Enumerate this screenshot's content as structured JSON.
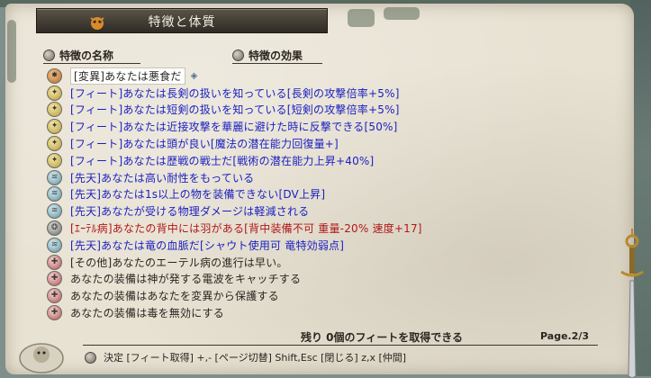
{
  "window": {
    "title": "特徴と体質"
  },
  "headers": {
    "name": "特徴の名称",
    "effect": "特徴の効果"
  },
  "colors": {
    "text_blue": "#1a1fc0",
    "text_red": "#b01818",
    "text_dark": "#2a2620",
    "title_bg": "#3a352d"
  },
  "traits": [
    {
      "icon": "mutation",
      "color": "dark",
      "text": "[変異]あなたは悪食だ",
      "selected": true
    },
    {
      "icon": "feat",
      "color": "blue",
      "text": "[フィート]あなたは長剣の扱いを知っている[長剣の攻撃倍率+5%]"
    },
    {
      "icon": "feat",
      "color": "blue",
      "text": "[フィート]あなたは短剣の扱いを知っている[短剣の攻撃倍率+5%]"
    },
    {
      "icon": "feat",
      "color": "blue",
      "text": "[フィート]あなたは近接攻撃を華麗に避けた時に反撃できる[50%]"
    },
    {
      "icon": "feat",
      "color": "blue",
      "text": "[フィート]あなたは頭が良い[魔法の潜在能力回復量+]"
    },
    {
      "icon": "feat",
      "color": "blue",
      "text": "[フィート]あなたは歴戦の戦士だ[戦術の潜在能力上昇+40%]"
    },
    {
      "icon": "innate",
      "color": "blue",
      "text": "[先天]あなたは高い耐性をもっている"
    },
    {
      "icon": "innate",
      "color": "blue",
      "text": "[先天]あなたは1s以上の物を装備できない[DV上昇]"
    },
    {
      "icon": "innate",
      "color": "blue",
      "text": "[先天]あなたが受ける物理ダメージは軽減される"
    },
    {
      "icon": "ether",
      "color": "red",
      "text": "[ｴｰﾃﾙ病]あなたの背中には羽がある[背中装備不可 重量-20% 速度+17]"
    },
    {
      "icon": "innate",
      "color": "blue",
      "text": "[先天]あなたは竜の血脈だ[シャウト使用可 竜特効弱点]"
    },
    {
      "icon": "other",
      "color": "dark",
      "text": "[その他]あなたのエーテル病の進行は早い。"
    },
    {
      "icon": "other",
      "color": "dark",
      "text": "あなたの装備は神が発する電波をキャッチする"
    },
    {
      "icon": "other",
      "color": "dark",
      "text": "あなたの装備はあなたを変異から保護する"
    },
    {
      "icon": "other",
      "color": "dark",
      "text": "あなたの装備は毒を無効にする"
    }
  ],
  "footer": {
    "remaining": "残り 0個のフィートを取得できる",
    "page": "Page.2/3",
    "help": "決定 [フィート取得]  +,- [ページ切替]  Shift,Esc [閉じる]  z,x [仲間]"
  }
}
